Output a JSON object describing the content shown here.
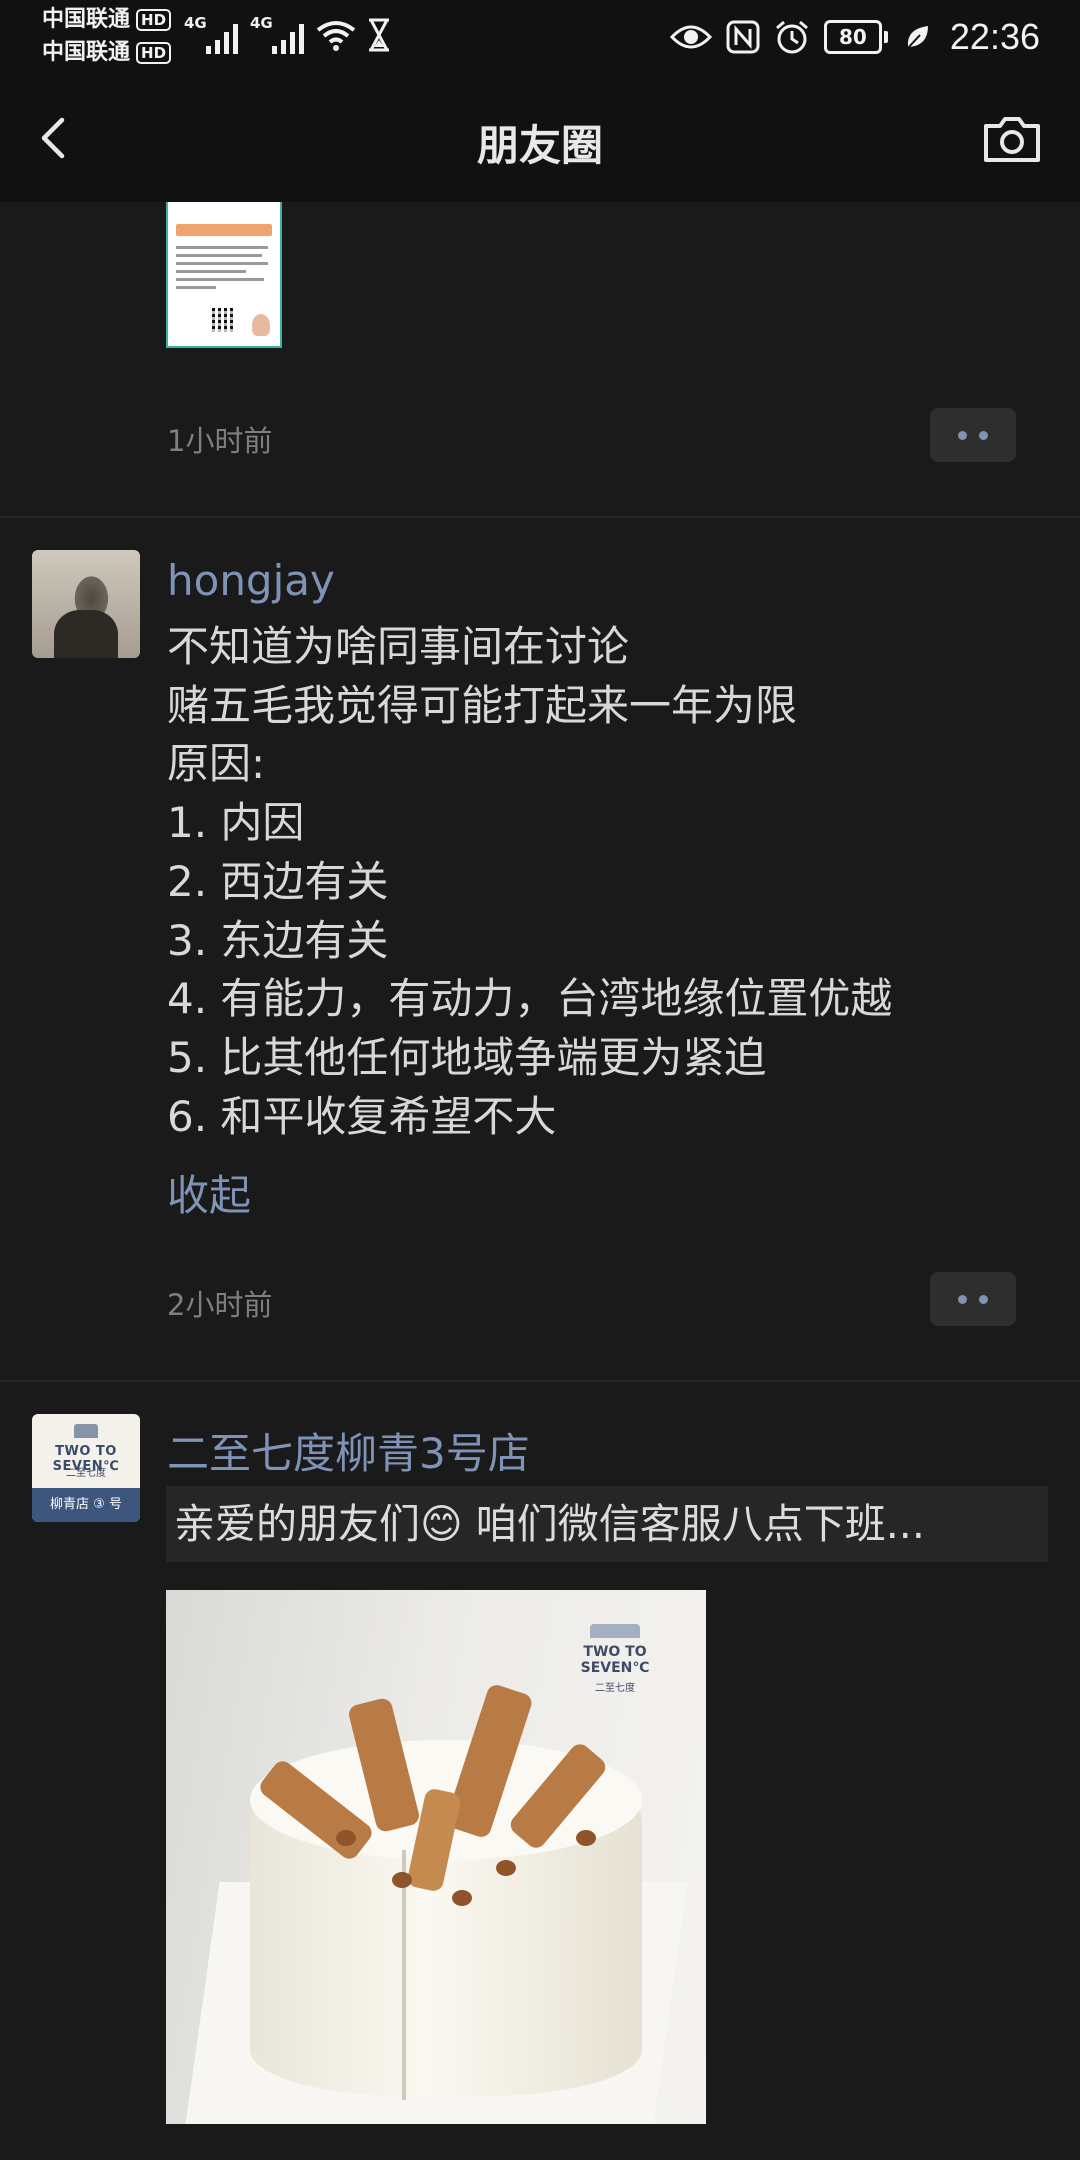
{
  "status_bar": {
    "carrier_1": "中国联通",
    "carrier_2": "中国联通",
    "hd_badge": "HD",
    "signal_1_label": "4G",
    "signal_2_label": "4G",
    "battery_level": "80",
    "time": "22:36",
    "icons": [
      "wifi-icon",
      "hourglass-icon",
      "eye-icon",
      "nfc-icon",
      "alarm-icon",
      "battery-icon",
      "leaf-icon"
    ]
  },
  "nav": {
    "title": "朋友圈",
    "icons": [
      "back-icon",
      "camera-icon"
    ]
  },
  "feed": {
    "post_0": {
      "time": "1小时前"
    },
    "post_1": {
      "nickname": "hongjay",
      "text": "不知道为啥同事间在讨论\n赌五毛我觉得可能打起来一年为限\n原因:\n1. 内因\n2. 西边有关\n3. 东边有关\n4. 有能力，有动力，台湾地缘位置优越\n5. 比其他任何地域争端更为紧迫\n6. 和平收复希望不大",
      "collapse_label": "收起",
      "time": "2小时前"
    },
    "post_2": {
      "nickname": "二至七度柳青3号店",
      "shared_text": "亲爱的朋友们😊  咱们微信客服八点下班...",
      "avatar_logo": "TWO TO SEVEN℃",
      "avatar_sub": "二至七度",
      "avatar_band": "柳青店 ③ 号",
      "image_brand": "TWO TO SEVEN℃",
      "image_brand_sub": "二至七度"
    }
  }
}
